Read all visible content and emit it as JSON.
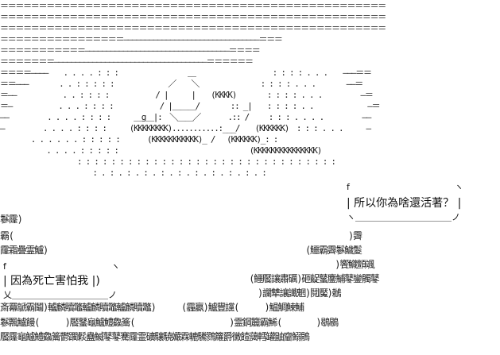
{
  "art_lines": [
    "＝＝＝＝＝＝＝＝＝＝＝＝＝＝＝＝＝＝＝＝＝＝＝＝＝＝＝＝＝＝＝＝＝＝＝＝＝＝＝＝＝＝＝＝＝＝＝＝＝＝",
    "＝＝＝＝＝＝＝＝＝＝＝＝＝＝＝＝＝＝＝＝＝＝＝＝＝＝＝＝＝＝＝＝＝＝＝＝＝＝＝＝＝＝＝＝＝＝＝＝＝＝",
    "＝＝＝＝＝＝＝＝＝＝＝＝＝＝＝＝＝＝＝＝＝＝＝＝＝＝＝＝＝＝＝＝＝＝＝＝＝＝＝＝＝＝＝＝＝＝＝＝＝＝",
    "＝＝＝＝＝＝＝＝＝＝＝＝＝＝＝＝――――――――――――――――――――――――――――――――＝＝＝",
    "＝＝＝＝＝＝＝＝＝＝＝――――――――――――――――――――――――――――――――――＝＝＝＝",
    "＝＝＝＝＝＝＝――――――――――――――――――――――――――――――――――――＝＝＝＝＝＝",
    "＝＝＝＝――――　　. . . . : : :　　　　　　　　　＿　　　　　　　　　　: : : : . . .　　―――＝＝",
    "＝＝―――　　　　. . : : : : :　　　　　　　／　　＼　　　　　　　　: : : : . . .　　　　――＝",
    "＝――　　　　　　. . : : : :　　　　　　/ |　　　|　　(KKKK)　　　　: : : : . . .　　　　　―＝",
    "＝―　　　　　　. . . : : : :　　　　　　/ |＿＿＿/　　　　:: _|　　: : : : . .　　　　　　　―＝",
    "――　　　　　. . . . : : : :　　　＿g＿|:　＼＿＿／　　　 .:: /　　 : : : . . . .　　　　　――",
    "―　　　　　. . . . : : : :　　　(KKKKKKKK)...........:___/　　(KKKKKK)　: : : . . .　　　―",
    "　　　　. . . . . . : : : : :　　　 (KKKKKKKKKKK)_ /　 (KKKKKK)_: :　　　　　",
    "　　　　　　. . . . : : : : :　　　　　　　　　　　　　　　　　(KKKKKKKKKKKKKKK)",
    "　　　　　　　　　　: : : : : : : : : : : : : : : : : : : : : : : : : : : : : : :",
    "　　　　　　　　　　　　: . : . : . : . : . : . : . : . : . : . :"
  ],
  "scene_lines": [
    "鬖霳)",
    "霸(　　　　　　　　　　　　　　　　　　　　　　　　　　　　　　　　　　　　　　　)霽",
    "霳霜疊霊鱸)　　　　　　　　　　　　　　　　　　　　　　　　　　　　　　(鱷霸霽鬖鱥鬉",
    "　　　　　　　　　　　　　　　　　　　　　　　　　　　　　　　　　　　　　　　)饗鱵顫颯",
    "　　　　　　　　　　　　　　　　　　　　　　　　　　　　　(鱷饜讓肅礪)砸齪鼜鏖鯆鼕鑾髑鼕",
    "　　　　　　　　　　　　　　　　　　　　　　　　　　　　　　)讕犨讓讖魍)鬩魘)鶒",
    "斎羃鷈霸鬮)轤麟贖鼈轤麟贖鼈轤麟贖鼈)　　　(霾贏)鱸豐讜(　　　)鰛鯛鰊鯆",
    "鬖飄鱸饅(　　　)饜鼜龜鱸鱧鱻籥(　　　　　　　　　　　)霊鋼籭霸鯑(　　　　)鶡鶍",
    "饜霳龜鱸鱧鱻籥鬱躙鬏蠱鰄鼕鼕騫霳霊礦驤驍孍霖轆驣鷚籮爵黴饐藹轌罐鼬齏鰯鶻"
  ],
  "bubble_right": {
    "top_line": "f　　　　　　　　　　　　ヽ",
    "text": "| 所以你為啥還活著？ |",
    "bottom_line": "ヽ＿＿＿＿＿＿＿＿＿＿＿ノ"
  },
  "bubble_left": {
    "top_line": "f　　　　　　　　　　　　ヽ",
    "text": "| 因為死亡害怕我 |)",
    "bottom_line": "乂＿＿＿＿＿＿＿＿＿＿＿ノ"
  }
}
